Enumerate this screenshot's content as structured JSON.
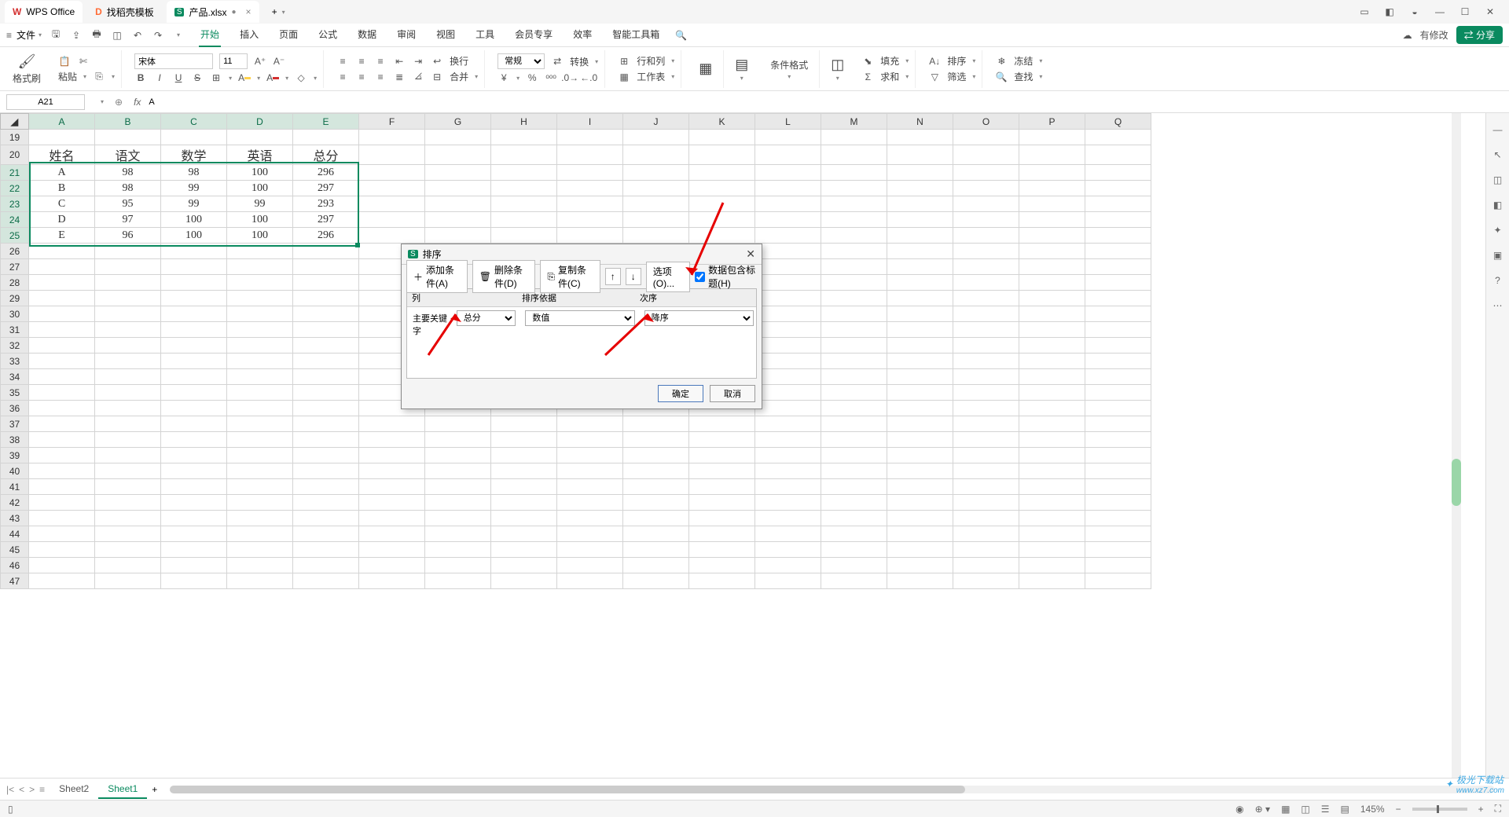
{
  "titlebar": {
    "app_tab": "WPS Office",
    "template_tab": "找稻壳模板",
    "file_tab": "产品.xlsx",
    "plus": "+"
  },
  "menubar": {
    "file": "文件",
    "tabs": [
      "开始",
      "插入",
      "页面",
      "公式",
      "数据",
      "审阅",
      "视图",
      "工具",
      "会员专享",
      "效率",
      "智能工具箱"
    ],
    "has_modify": "有修改",
    "share": "分享"
  },
  "ribbon": {
    "format_painter": "格式刷",
    "paste": "粘贴",
    "font_name": "宋体",
    "font_size": "11",
    "bold": "B",
    "italic": "I",
    "underline": "U",
    "strike": "S",
    "wrap": "换行",
    "merge": "合并",
    "normal": "常规",
    "convert": "转换",
    "row_col": "行和列",
    "worksheet": "工作表",
    "cond_fmt": "条件格式",
    "fill": "填充",
    "sort": "排序",
    "freeze": "冻结",
    "sum": "求和",
    "filter": "筛选",
    "find": "查找"
  },
  "namebox": {
    "cell": "A21",
    "fx": "fx",
    "formula": "A"
  },
  "columns": [
    "A",
    "B",
    "C",
    "D",
    "E",
    "F",
    "G",
    "H",
    "I",
    "J",
    "K",
    "L",
    "M",
    "N",
    "O",
    "P",
    "Q"
  ],
  "row_start": 19,
  "row_end": 47,
  "headers": [
    "姓名",
    "语文",
    "数学",
    "英语",
    "总分"
  ],
  "data": [
    [
      "A",
      "98",
      "98",
      "100",
      "296"
    ],
    [
      "B",
      "98",
      "99",
      "100",
      "297"
    ],
    [
      "C",
      "95",
      "99",
      "99",
      "293"
    ],
    [
      "D",
      "97",
      "100",
      "100",
      "297"
    ],
    [
      "E",
      "96",
      "100",
      "100",
      "296"
    ]
  ],
  "sheets": {
    "nav": [
      "|<",
      "<",
      ">"
    ],
    "items": [
      "Sheet2",
      "Sheet1"
    ],
    "active": "Sheet1",
    "add": "+"
  },
  "statusbar": {
    "zoom": "145%"
  },
  "dialog": {
    "title": "排序",
    "add": "添加条件(A)",
    "del": "删除条件(D)",
    "copy": "复制条件(C)",
    "options": "选项(O)...",
    "hdr_check": "数据包含标题(H)",
    "col_label": "列",
    "basis_label": "排序依据",
    "order_label": "次序",
    "key_label": "主要关键字",
    "key_value": "总分",
    "basis_value": "数值",
    "order_value": "降序",
    "ok": "确定",
    "cancel": "取消"
  },
  "watermark": {
    "text": "极光下载站",
    "url": "www.xz7.com"
  }
}
